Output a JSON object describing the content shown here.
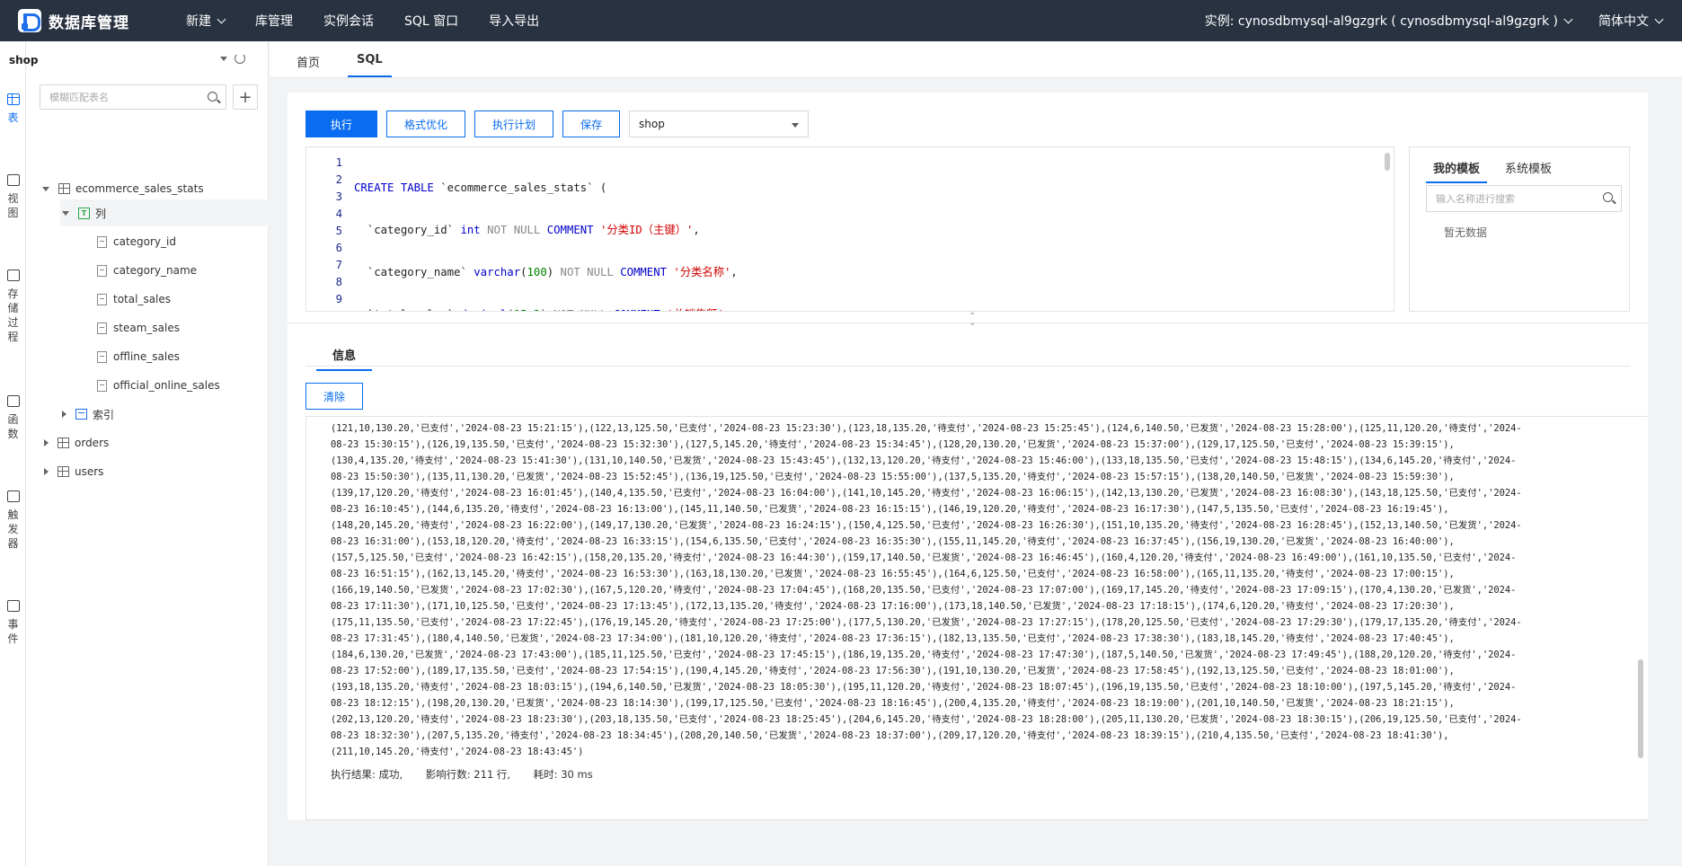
{
  "app": {
    "title": "数据库管理",
    "nav": [
      {
        "label": "新建",
        "dropdown": true
      },
      {
        "label": "库管理",
        "dropdown": false
      },
      {
        "label": "实例会话",
        "dropdown": false
      },
      {
        "label": "SQL 窗口",
        "dropdown": false
      },
      {
        "label": "导入导出",
        "dropdown": false
      }
    ],
    "instance_label": "实例: cynosdbmysql-al9gzgrk ( cynosdbmysql-al9gzgrk )",
    "language": "简体中文"
  },
  "rail": [
    {
      "label": "表",
      "icon": "table-icon",
      "active": true
    },
    {
      "label": "视图",
      "icon": "view-icon",
      "active": false
    },
    {
      "label": "存储过程",
      "icon": "procedure-icon",
      "active": false
    },
    {
      "label": "函数",
      "icon": "function-icon",
      "active": false
    },
    {
      "label": "触发器",
      "icon": "trigger-icon",
      "active": false
    },
    {
      "label": "事件",
      "icon": "event-icon",
      "active": false
    }
  ],
  "sidebar": {
    "database": "shop",
    "search_placeholder": "模糊匹配表名",
    "tree": {
      "table1": "ecommerce_sales_stats",
      "columns_group": "列",
      "columns": [
        "category_id",
        "category_name",
        "total_sales",
        "steam_sales",
        "offline_sales",
        "official_online_sales"
      ],
      "index_group": "索引",
      "table2": "orders",
      "table3": "users"
    }
  },
  "tabs": {
    "home": "首页",
    "sql": "SQL"
  },
  "toolbar": {
    "execute": "执行",
    "format": "格式优化",
    "plan": "执行计划",
    "save": "保存",
    "db": "shop"
  },
  "editor": {
    "line_numbers": [
      "1",
      "2",
      "3",
      "4",
      "5",
      "6",
      "7",
      "8",
      "9"
    ]
  },
  "templates": {
    "tab_mine": "我的模板",
    "tab_system": "系统模板",
    "search_placeholder": "输入名称进行搜索",
    "empty": "暂无数据"
  },
  "info": {
    "tab": "信息",
    "clear": "清除",
    "output_lines": [
      "(121,10,130.20,'已支付','2024-08-23 15:21:15'),(122,13,125.50,'已支付','2024-08-23 15:23:30'),(123,18,135.20,'待支付','2024-08-23 15:25:45'),(124,6,140.50,'已发货','2024-08-23 15:28:00'),(125,11,120.20,'待支付','2024-",
      "08-23 15:30:15'),(126,19,135.50,'已支付','2024-08-23 15:32:30'),(127,5,145.20,'待支付','2024-08-23 15:34:45'),(128,20,130.20,'已发货','2024-08-23 15:37:00'),(129,17,125.50,'已支付','2024-08-23 15:39:15'),",
      "(130,4,135.20,'待支付','2024-08-23 15:41:30'),(131,10,140.50,'已发货','2024-08-23 15:43:45'),(132,13,120.20,'待支付','2024-08-23 15:46:00'),(133,18,135.50,'已支付','2024-08-23 15:48:15'),(134,6,145.20,'待支付','2024-",
      "08-23 15:50:30'),(135,11,130.20,'已发货','2024-08-23 15:52:45'),(136,19,125.50,'已支付','2024-08-23 15:55:00'),(137,5,135.20,'待支付','2024-08-23 15:57:15'),(138,20,140.50,'已发货','2024-08-23 15:59:30'),",
      "(139,17,120.20,'待支付','2024-08-23 16:01:45'),(140,4,135.50,'已支付','2024-08-23 16:04:00'),(141,10,145.20,'待支付','2024-08-23 16:06:15'),(142,13,130.20,'已发货','2024-08-23 16:08:30'),(143,18,125.50,'已支付','2024-",
      "08-23 16:10:45'),(144,6,135.20,'待支付','2024-08-23 16:13:00'),(145,11,140.50,'已发货','2024-08-23 16:15:15'),(146,19,120.20,'待支付','2024-08-23 16:17:30'),(147,5,135.50,'已支付','2024-08-23 16:19:45'),",
      "(148,20,145.20,'待支付','2024-08-23 16:22:00'),(149,17,130.20,'已发货','2024-08-23 16:24:15'),(150,4,125.50,'已支付','2024-08-23 16:26:30'),(151,10,135.20,'待支付','2024-08-23 16:28:45'),(152,13,140.50,'已发货','2024-",
      "08-23 16:31:00'),(153,18,120.20,'待支付','2024-08-23 16:33:15'),(154,6,135.50,'已支付','2024-08-23 16:35:30'),(155,11,145.20,'待支付','2024-08-23 16:37:45'),(156,19,130.20,'已发货','2024-08-23 16:40:00'),",
      "(157,5,125.50,'已支付','2024-08-23 16:42:15'),(158,20,135.20,'待支付','2024-08-23 16:44:30'),(159,17,140.50,'已发货','2024-08-23 16:46:45'),(160,4,120.20,'待支付','2024-08-23 16:49:00'),(161,10,135.50,'已支付','2024-",
      "08-23 16:51:15'),(162,13,145.20,'待支付','2024-08-23 16:53:30'),(163,18,130.20,'已发货','2024-08-23 16:55:45'),(164,6,125.50,'已支付','2024-08-23 16:58:00'),(165,11,135.20,'待支付','2024-08-23 17:00:15'),",
      "(166,19,140.50,'已发货','2024-08-23 17:02:30'),(167,5,120.20,'待支付','2024-08-23 17:04:45'),(168,20,135.50,'已支付','2024-08-23 17:07:00'),(169,17,145.20,'待支付','2024-08-23 17:09:15'),(170,4,130.20,'已发货','2024-",
      "08-23 17:11:30'),(171,10,125.50,'已支付','2024-08-23 17:13:45'),(172,13,135.20,'待支付','2024-08-23 17:16:00'),(173,18,140.50,'已发货','2024-08-23 17:18:15'),(174,6,120.20,'待支付','2024-08-23 17:20:30'),",
      "(175,11,135.50,'已支付','2024-08-23 17:22:45'),(176,19,145.20,'待支付','2024-08-23 17:25:00'),(177,5,130.20,'已发货','2024-08-23 17:27:15'),(178,20,125.50,'已支付','2024-08-23 17:29:30'),(179,17,135.20,'待支付','2024-",
      "08-23 17:31:45'),(180,4,140.50,'已发货','2024-08-23 17:34:00'),(181,10,120.20,'待支付','2024-08-23 17:36:15'),(182,13,135.50,'已支付','2024-08-23 17:38:30'),(183,18,145.20,'待支付','2024-08-23 17:40:45'),",
      "(184,6,130.20,'已发货','2024-08-23 17:43:00'),(185,11,125.50,'已支付','2024-08-23 17:45:15'),(186,19,135.20,'待支付','2024-08-23 17:47:30'),(187,5,140.50,'已发货','2024-08-23 17:49:45'),(188,20,120.20,'待支付','2024-",
      "08-23 17:52:00'),(189,17,135.50,'已支付','2024-08-23 17:54:15'),(190,4,145.20,'待支付','2024-08-23 17:56:30'),(191,10,130.20,'已发货','2024-08-23 17:58:45'),(192,13,125.50,'已支付','2024-08-23 18:01:00'),",
      "(193,18,135.20,'待支付','2024-08-23 18:03:15'),(194,6,140.50,'已发货','2024-08-23 18:05:30'),(195,11,120.20,'待支付','2024-08-23 18:07:45'),(196,19,135.50,'已支付','2024-08-23 18:10:00'),(197,5,145.20,'待支付','2024-",
      "08-23 18:12:15'),(198,20,130.20,'已发货','2024-08-23 18:14:30'),(199,17,125.50,'已支付','2024-08-23 18:16:45'),(200,4,135.20,'待支付','2024-08-23 18:19:00'),(201,10,140.50,'已发货','2024-08-23 18:21:15'),",
      "(202,13,120.20,'待支付','2024-08-23 18:23:30'),(203,18,135.50,'已支付','2024-08-23 18:25:45'),(204,6,145.20,'待支付','2024-08-23 18:28:00'),(205,11,130.20,'已发货','2024-08-23 18:30:15'),(206,19,125.50,'已支付','2024-",
      "08-23 18:32:30'),(207,5,135.20,'待支付','2024-08-23 18:34:45'),(208,20,140.50,'已发货','2024-08-23 18:37:00'),(209,17,120.20,'待支付','2024-08-23 18:39:15'),(210,4,135.50,'已支付','2024-08-23 18:41:30'),",
      "(211,10,145.20,'待支付','2024-08-23 18:43:45')"
    ],
    "result_label": "执行结果: 成功,",
    "affected_label": "影响行数: 211 行,",
    "time_label": "耗时: 30 ms"
  },
  "colors": {
    "accent": "#0a6cf0",
    "topbar": "#293241",
    "sql_string": "#d00000",
    "sql_keyword": "#0000cc",
    "sql_type": "#008000"
  }
}
